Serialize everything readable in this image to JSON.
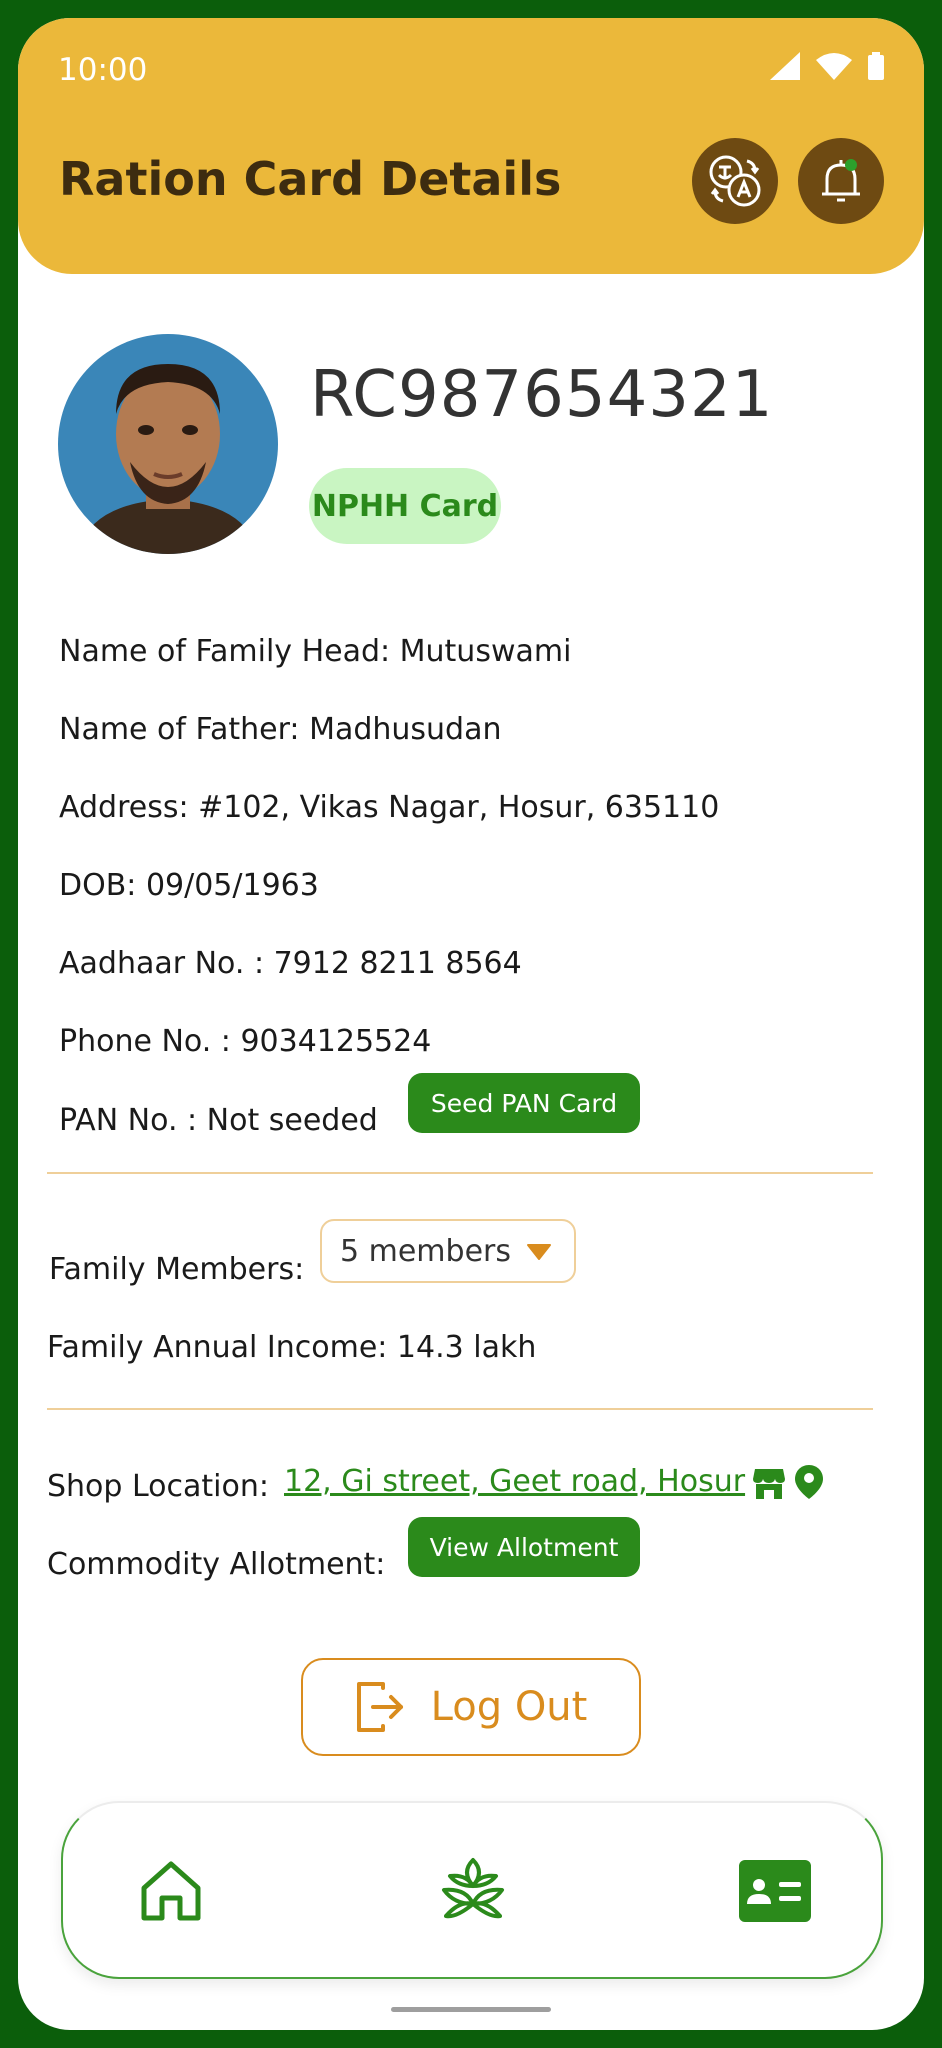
{
  "status_bar": {
    "time": "10:00"
  },
  "header": {
    "title": "Ration Card Details"
  },
  "profile": {
    "card_number": "RC987654321",
    "card_type": "NPHH Card"
  },
  "details": {
    "family_head": "Name of Family Head: Mutuswami",
    "father": "Name of Father: Madhusudan",
    "address": "Address: #102, Vikas Nagar, Hosur, 635110",
    "dob": "DOB: 09/05/1963",
    "aadhaar": "Aadhaar No. : 7912 8211 8564",
    "phone": "Phone No. : 9034125524",
    "pan": "PAN No. : Not seeded",
    "seed_pan_label": "Seed PAN Card"
  },
  "family": {
    "members_label": "Family Members:",
    "members_value": "5 members",
    "income": "Family Annual Income: 14.3 lakh"
  },
  "shop": {
    "location_label": "Shop Location:",
    "location_value": "12, Gi street, Geet road, Hosur",
    "allotment_label": "Commodity Allotment:",
    "view_allotment_label": "View Allotment"
  },
  "logout_label": "Log Out",
  "bottom_nav": {
    "items": [
      "home-icon",
      "wheat-icon",
      "id-card-icon"
    ],
    "active": "id-card-icon"
  },
  "colors": {
    "header": "#ebb83a",
    "frame": "#0b5e0b",
    "accent_green": "#2b8a1b",
    "accent_orange": "#d98c1e"
  }
}
